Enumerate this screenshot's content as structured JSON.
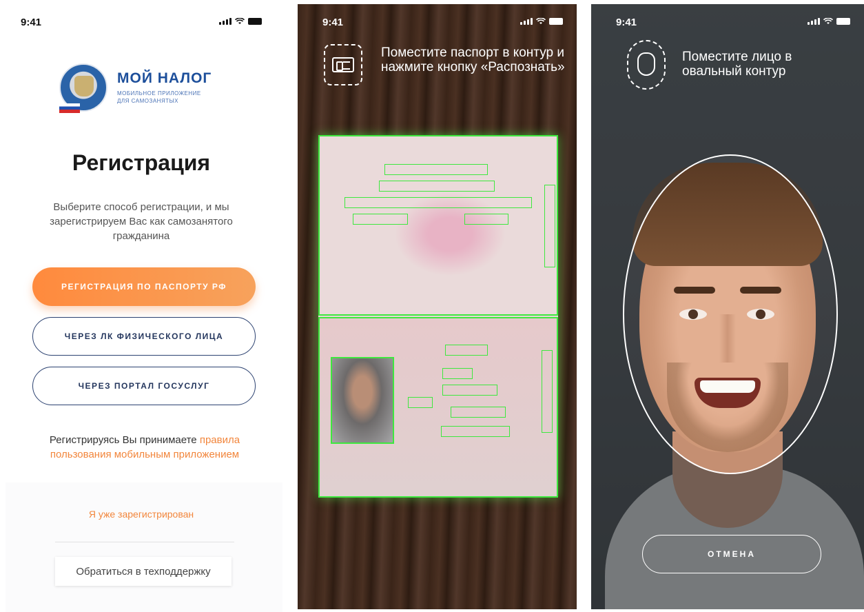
{
  "screen_register": {
    "status_time": "9:41",
    "logo": {
      "name": "МОЙ НАЛОГ",
      "subtitle_line1": "МОБИЛЬНОЕ ПРИЛОЖЕНИЕ",
      "subtitle_line2": "ДЛЯ САМОЗАНЯТЫХ"
    },
    "title": "Регистрация",
    "description": "Выберите способ регистрации, и мы зарегистрируем Вас как самозанятого гражданина",
    "buttons": {
      "passport": "РЕГИСТРАЦИЯ ПО ПАСПОРТУ РФ",
      "lk": "ЧЕРЕЗ ЛК ФИЗИЧЕСКОГО ЛИЦА",
      "gosuslugi": "ЧЕРЕЗ ПОРТАЛ ГОСУСЛУГ"
    },
    "terms_prefix": "Регистрируясь Вы принимаете ",
    "terms_link": "правила пользования мобильным приложением",
    "already_registered": "Я уже зарегистрирован",
    "support": "Обратиться в техподдержку"
  },
  "screen_passport": {
    "status_time": "9:41",
    "instruction": "Поместите паспорт в контур и нажмите кнопку «Распознать»"
  },
  "screen_face": {
    "status_time": "9:41",
    "instruction": "Поместите лицо в овальный контур",
    "cancel": "ОТМЕНА"
  },
  "colors": {
    "accent_orange": "#f2863c",
    "brand_blue": "#1d4f9b",
    "scan_green": "#3ee83e"
  }
}
